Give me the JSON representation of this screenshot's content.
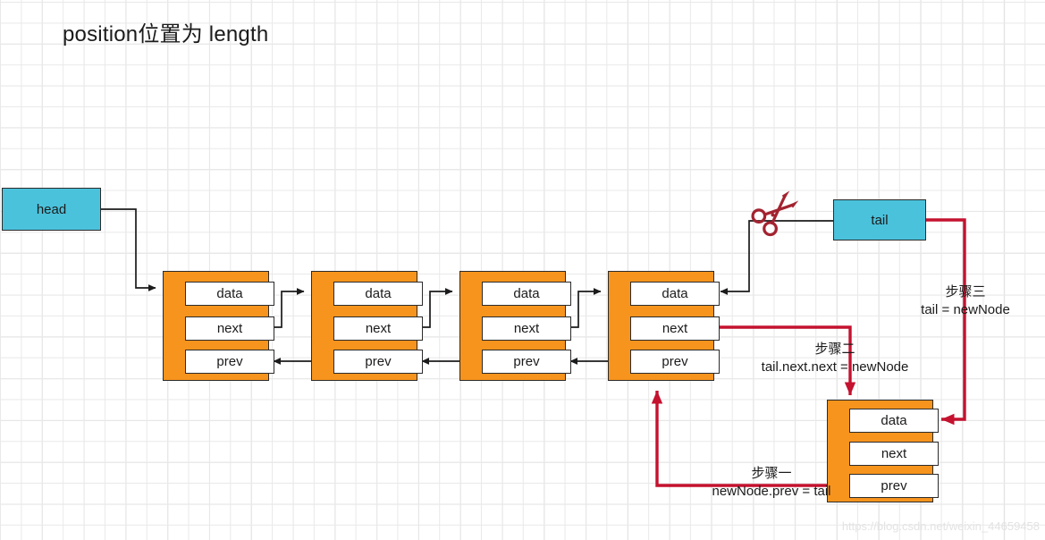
{
  "title": "position位置为 length",
  "colors": {
    "pointer_fill": "#4BC2DC",
    "node_fill": "#F7941D",
    "field_fill": "#FFFFFF",
    "stroke": "#2B2B2B",
    "highlight": "#C4122F",
    "scissors": "#A32330",
    "grid_minor": "#E9E9E9",
    "grid_major": "#D6D6D6",
    "watermark": "#E3E3E3"
  },
  "pointers": {
    "head": "head",
    "tail": "tail"
  },
  "icons": {
    "scissors": "scissors-icon"
  },
  "fields": {
    "data": "data",
    "next": "next",
    "prev": "prev"
  },
  "nodes": [
    {
      "id": "node-1",
      "fields": [
        "data",
        "next",
        "prev"
      ]
    },
    {
      "id": "node-2",
      "fields": [
        "data",
        "next",
        "prev"
      ]
    },
    {
      "id": "node-3",
      "fields": [
        "data",
        "next",
        "prev"
      ]
    },
    {
      "id": "node-4",
      "fields": [
        "data",
        "next",
        "prev"
      ]
    },
    {
      "id": "new-node",
      "fields": [
        "data",
        "next",
        "prev"
      ]
    }
  ],
  "annotations": [
    {
      "id": "step-one",
      "step": "步骤一",
      "code": "newNode.prev = tail"
    },
    {
      "id": "step-two",
      "step": "步骤二",
      "code": "tail.next.next = newNode"
    },
    {
      "id": "step-three",
      "step": "步骤三",
      "code": "tail = newNode"
    }
  ],
  "watermark": "https://blog.csdn.net/weixin_44659458"
}
